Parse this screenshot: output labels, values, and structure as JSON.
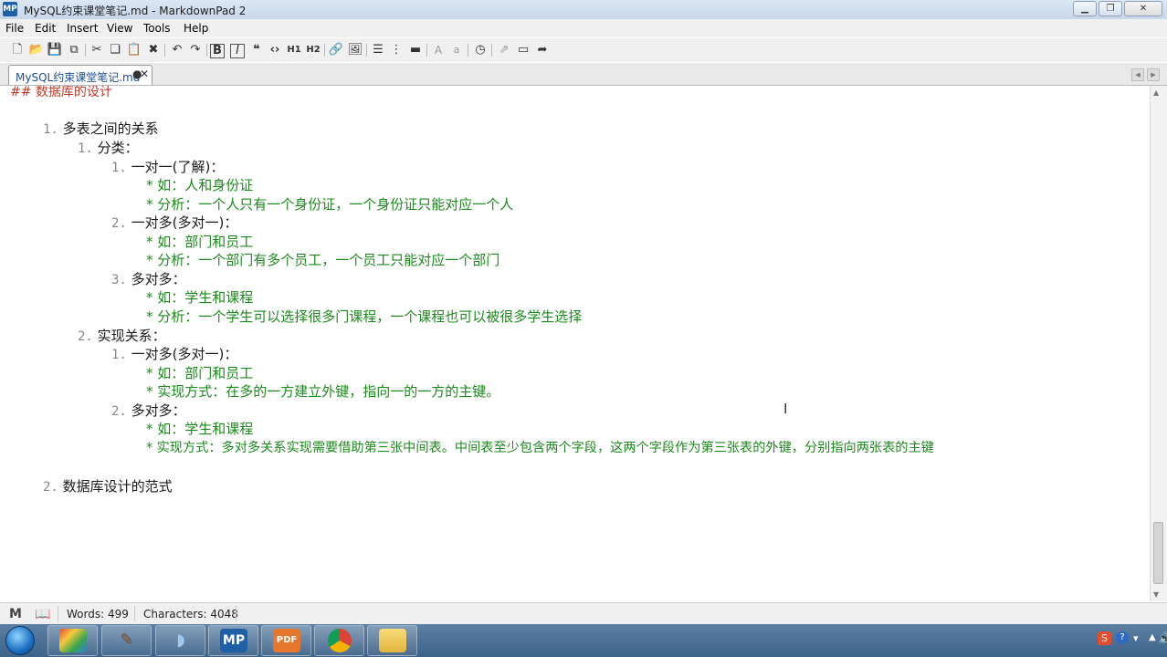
{
  "window": {
    "app_icon": "MP",
    "title": "MySQL约束课堂笔记.md - MarkdownPad 2",
    "controls": [
      "minimize",
      "maximize",
      "close"
    ]
  },
  "menu": [
    "File",
    "Edit",
    "Insert",
    "View",
    "Tools",
    "Help"
  ],
  "toolbar": {
    "icons": [
      "new-file-icon",
      "open-folder-icon",
      "save-icon",
      "save-all-icon",
      "cut-icon",
      "copy-icon",
      "paste-icon",
      "delete-icon",
      "undo-icon",
      "redo-icon",
      "bold-icon",
      "italic-icon",
      "quote-icon",
      "code-icon",
      "heading1-icon",
      "heading2-icon",
      "link-icon",
      "image-icon",
      "unordered-list-icon",
      "ordered-list-icon",
      "horizontal-rule-icon",
      "uppercase-icon",
      "lowercase-icon",
      "timestamp-icon",
      "toggle-preview-icon",
      "live-preview-icon",
      "export-icon"
    ],
    "h1_label": "H1",
    "h2_label": "H2"
  },
  "tab": {
    "label": "MySQL约束课堂笔记.md",
    "dirty": "●",
    "close": "✕"
  },
  "editor": {
    "partial_heading": "## 数据库的设计",
    "lines": [
      {
        "num": "1.",
        "text": "多表之间的关系",
        "kind": "item"
      },
      {
        "num": "1.",
        "text": "分类：",
        "kind": "item"
      },
      {
        "num": "1.",
        "text": "一对一(了解)：",
        "kind": "item"
      },
      {
        "num": "*",
        "text": "如：人和身份证",
        "kind": "bullet"
      },
      {
        "num": "*",
        "text": "分析：一个人只有一个身份证，一个身份证只能对应一个人",
        "kind": "bullet"
      },
      {
        "num": "2.",
        "text": "一对多(多对一)：",
        "kind": "item"
      },
      {
        "num": "*",
        "text": "如：部门和员工",
        "kind": "bullet"
      },
      {
        "num": "*",
        "text": "分析：一个部门有多个员工，一个员工只能对应一个部门",
        "kind": "bullet"
      },
      {
        "num": "3.",
        "text": "多对多：",
        "kind": "item"
      },
      {
        "num": "*",
        "text": "如：学生和课程",
        "kind": "bullet"
      },
      {
        "num": "*",
        "text": "分析：一个学生可以选择很多门课程，一个课程也可以被很多学生选择",
        "kind": "bullet"
      },
      {
        "num": "2.",
        "text": "实现关系：",
        "kind": "item"
      },
      {
        "num": "1.",
        "text": "一对多(多对一)：",
        "kind": "item"
      },
      {
        "num": "*",
        "text": "如：部门和员工",
        "kind": "bullet"
      },
      {
        "num": "*",
        "text": "实现方式：在多的一方建立外键，指向一的一方的主键。",
        "kind": "bullet"
      },
      {
        "num": "2.",
        "text": "多对多：",
        "kind": "item"
      },
      {
        "num": "*",
        "text": "如：学生和课程",
        "kind": "bullet"
      },
      {
        "num": "*",
        "text": "实现方式：多对多关系实现需要借助第三张中间表。中间表至少包含两个字段，这两个字段作为第三张表的外键，分别指向两张表的主键",
        "kind": "bullet"
      },
      {
        "num": "2.",
        "text": "数据库设计的范式",
        "kind": "item"
      }
    ]
  },
  "status": {
    "words": "Words: 499",
    "characters": "Characters: 4048"
  },
  "taskbar": {
    "apps": [
      "paint-app-icon",
      "pencil-app-icon",
      "dolphin-app-icon",
      "markdownpad-app-icon",
      "pdf-app-icon",
      "chrome-app-icon",
      "file-explorer-app-icon"
    ],
    "mp_label": "MP",
    "pdf_label": "PDF",
    "tray": [
      "sogou-ime-icon",
      "help-icon",
      "network-icon",
      "tray-expand-icon",
      "volume-icon"
    ]
  }
}
